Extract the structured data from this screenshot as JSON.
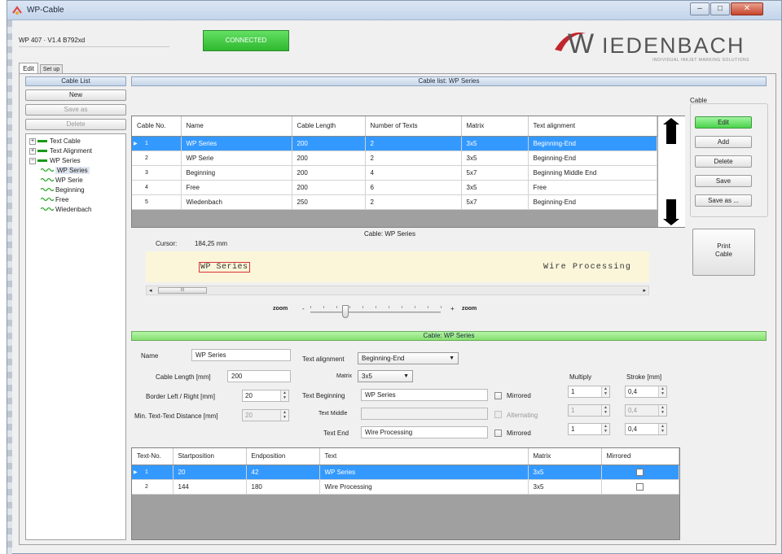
{
  "window": {
    "title": "WP-Cable",
    "min": "–",
    "max": "□",
    "close": "✕"
  },
  "header": {
    "version": "WP 407 · V1.4 B792xd",
    "status": "CONNECTED",
    "brand_prefix": "W",
    "brand": "IEDENBACH",
    "brand_tagline": "INDIVIDUAL INKJET MARKING SOLUTIONS"
  },
  "tabs": [
    "Edit",
    "Set up"
  ],
  "left": {
    "header": "Cable List",
    "new": "New",
    "save_as": "Save as",
    "delete": "Delete",
    "tree": [
      {
        "label": "Text Cable",
        "level": 0,
        "expander": "+"
      },
      {
        "label": "Text Alignment",
        "level": 0,
        "expander": "+"
      },
      {
        "label": "WP Series",
        "level": 0,
        "expander": "−"
      },
      {
        "label": "WP Series",
        "level": 1,
        "selected": true
      },
      {
        "label": "WP Serie",
        "level": 1
      },
      {
        "label": "Beginning",
        "level": 1
      },
      {
        "label": "Free",
        "level": 1
      },
      {
        "label": "Wiedenbach",
        "level": 1
      }
    ]
  },
  "cable_list": {
    "header": "Cable list: WP Series",
    "columns": [
      "Cable No.",
      "Name",
      "Cable Length",
      "Number of Texts",
      "Matrix",
      "Text alignment"
    ],
    "rows": [
      {
        "marker": "▶",
        "no": "1",
        "name": "WP Series",
        "length": "200",
        "texts": "2",
        "matrix": "3x5",
        "align": "Beginning-End",
        "selected": true
      },
      {
        "marker": "",
        "no": "2",
        "name": "WP Serie",
        "length": "200",
        "texts": "2",
        "matrix": "3x5",
        "align": "Beginning-End"
      },
      {
        "marker": "",
        "no": "3",
        "name": "Beginning",
        "length": "200",
        "texts": "4",
        "matrix": "5x7",
        "align": "Beginning Middle End"
      },
      {
        "marker": "",
        "no": "4",
        "name": "Free",
        "length": "200",
        "texts": "6",
        "matrix": "3x5",
        "align": "Free"
      },
      {
        "marker": "",
        "no": "5",
        "name": "Wiedenbach",
        "length": "250",
        "texts": "2",
        "matrix": "5x7",
        "align": "Beginning-End"
      }
    ]
  },
  "cable_group": {
    "title": "Cable",
    "edit": "Edit",
    "add": "Add",
    "delete": "Delete",
    "save": "Save",
    "save_as": "Save as ...",
    "print": "Print\nCable"
  },
  "preview": {
    "title": "Cable: WP Series",
    "cursor_label": "Cursor:",
    "cursor_value": "184,25 mm",
    "text_left": "WP Series",
    "text_right": "Wire Processing",
    "scroll_thumb": "III",
    "zoom_minus_label": "zoom",
    "zoom_minus": "-",
    "zoom_plus": "+",
    "zoom_plus_label": "zoom",
    "zoom_fraction": 0.27
  },
  "editor": {
    "header": "Cable: WP Series",
    "name_label": "Name",
    "name_value": "WP Series",
    "cable_length_label": "Cable Length [mm]",
    "cable_length_value": "200",
    "border_label": "Border Left / Right [mm]",
    "border_value": "20",
    "min_dist_label": "Min. Text-Text Distance [mm]",
    "min_dist_value": "20",
    "text_alignment_label": "Text alignment",
    "text_alignment_value": "Beginning-End",
    "matrix_label": "Matrix",
    "matrix_value": "3x5",
    "text_beginning_label": "Text Beginning",
    "text_beginning_value": "WP Series",
    "text_middle_label": "Text Middle",
    "text_middle_value": "",
    "text_end_label": "Text End",
    "text_end_value": "Wire Processing",
    "mirrored_label": "Mirrored",
    "alternating_label": "Alternating",
    "multiply_label": "Multiply",
    "stroke_label": "Stroke [mm]",
    "multiply_values": [
      "1",
      "1",
      "1"
    ],
    "stroke_values": [
      "0,4",
      "0,4",
      "0,4"
    ]
  },
  "texts_table": {
    "columns": [
      "Text-No.",
      "Startposition",
      "Endposition",
      "Text",
      "Matrix",
      "Mirrored"
    ],
    "rows": [
      {
        "marker": "▶",
        "no": "1",
        "start": "20",
        "end": "42",
        "text": "WP Series",
        "matrix": "3x5",
        "mirrored": false,
        "selected": true
      },
      {
        "marker": "",
        "no": "2",
        "start": "144",
        "end": "180",
        "text": "Wire Processing",
        "matrix": "3x5",
        "mirrored": false
      }
    ]
  },
  "colors": {
    "accent_green": "#4bd34b",
    "selection_blue": "#3399ff",
    "brand_red": "#c0272d",
    "preview_bg": "#fbf6da"
  }
}
